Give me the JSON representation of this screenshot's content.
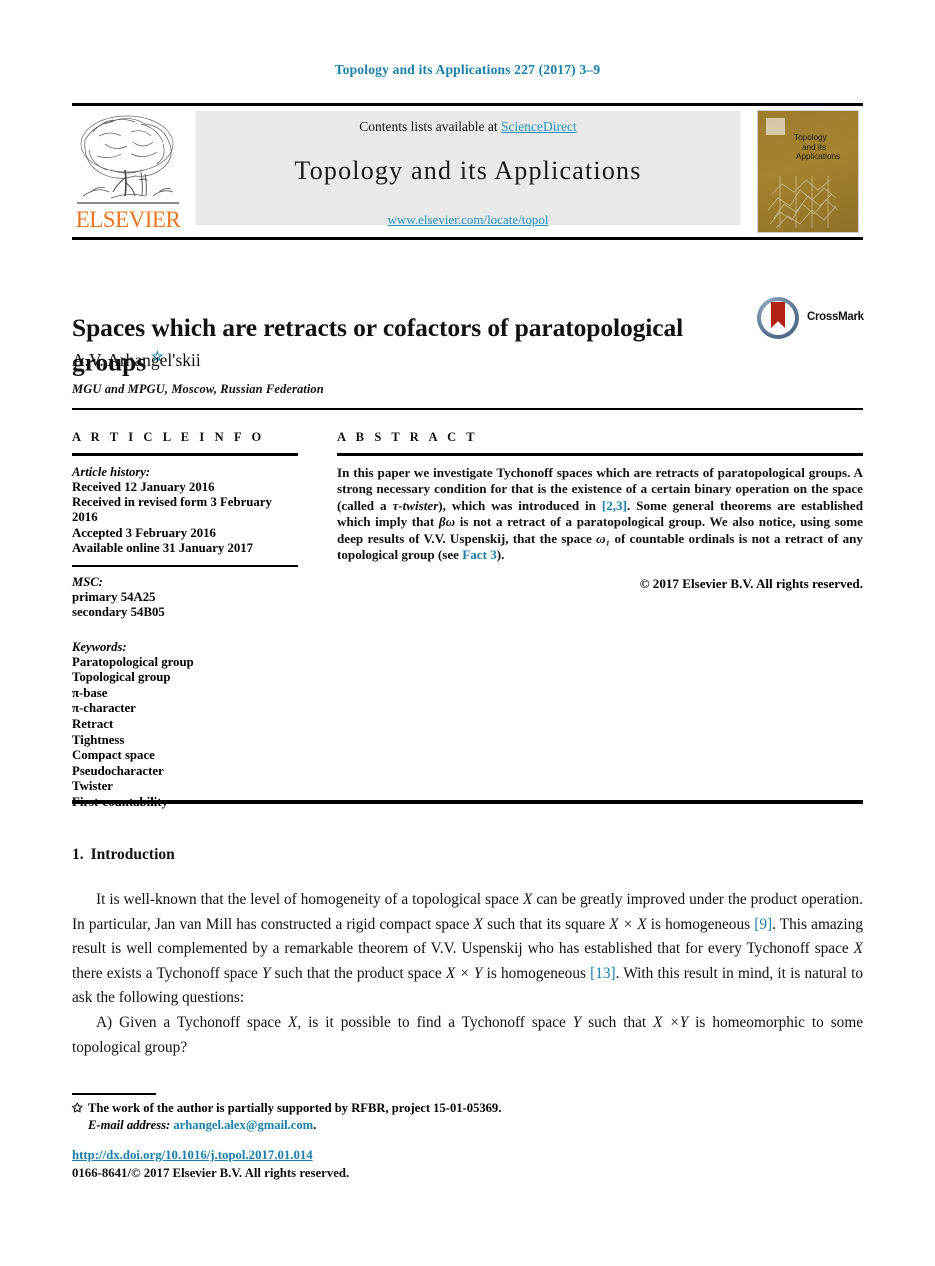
{
  "running_head": "Topology and its Applications 227 (2017) 3–9",
  "masthead": {
    "publisher_name": "ELSEVIER",
    "contents_prefix": "Contents lists available at ",
    "contents_link": "ScienceDirect",
    "journal_name": "Topology and its Applications",
    "journal_url": "www.elsevier.com/locate/topol",
    "cover": {
      "line1": "Topology",
      "line2": "and its",
      "line3": "Applications"
    }
  },
  "article": {
    "title": "Spaces which are retracts or cofactors of paratopological groups",
    "title_footnote_marker": "☆",
    "author": "A.V. Arhangel'skii",
    "affiliation": "MGU and MPGU, Moscow, Russian Federation"
  },
  "crossmark": {
    "label": "CrossMark"
  },
  "info": {
    "heading": "A R T I C L E   I N F O",
    "history_label": "Article history:",
    "history": [
      "Received 12 January 2016",
      "Received in revised form 3 February 2016",
      "Accepted 3 February 2016",
      "Available online 31 January 2017"
    ],
    "msc_label": "MSC:",
    "msc": [
      "primary 54A25",
      "secondary 54B05"
    ],
    "keywords_label": "Keywords:",
    "keywords": [
      "Paratopological group",
      "Topological group",
      "π-base",
      "π-character",
      "Retract",
      "Tightness",
      "Compact space",
      "Pseudocharacter",
      "Twister",
      "First-countability"
    ]
  },
  "abstract": {
    "heading": "A B S T R A C T",
    "part1": "In this paper we investigate Tychonoff spaces which are retracts of paratopological groups. A strong necessary condition for that is the existence of a certain binary operation on the space (called a ",
    "tau_twister": "τ-twister",
    "part2": "), which was introduced in ",
    "ref_23": "[2,3]",
    "part3": ". Some general theorems are established which imply that ",
    "beta_omega": "βω",
    "part4": " is not a retract of a paratopological group. We also notice, using some deep results of V.V. Uspenskij, that the space ",
    "omega_1": "ω₁",
    "part5": " of countable ordinals is not a retract of any topological group (see ",
    "ref_fact3": "Fact 3",
    "part6": ").",
    "copyright": "© 2017 Elsevier B.V. All rights reserved."
  },
  "body": {
    "section_number": "1.",
    "section_name": "Introduction",
    "p1_a": "It is well-known that the level of homogeneity of a topological space ",
    "p1_X1": "X",
    "p1_b": " can be greatly improved under the product operation. In particular, Jan van Mill has constructed a rigid compact space ",
    "p1_X2": "X",
    "p1_c": " such that its square ",
    "p1_XX": "X × X",
    "p1_d": " is homogeneous ",
    "p1_ref9": "[9]",
    "p1_e": ". This amazing result is well complemented by a remarkable theorem of V.V. Uspenskij who has established that for every Tychonoff space ",
    "p1_X3": "X",
    "p1_f": " there exists a Tychonoff space ",
    "p1_Y1": "Y",
    "p1_g": " such that the product space ",
    "p1_XY": "X × Y",
    "p1_h": " is homogeneous ",
    "p1_ref13": "[13]",
    "p1_i": ". With this result in mind, it is natural to ask the following questions:",
    "p2_a": "A) Given a Tychonoff space ",
    "p2_X1": "X",
    "p2_b": ", is it possible to find a Tychonoff space ",
    "p2_Y1": "Y",
    "p2_c": " such that ",
    "p2_XY": "X ×Y",
    "p2_d": " is homeomorphic to some topological group?"
  },
  "footnotes": {
    "star_marker": "✩",
    "support": "The work of the author is partially supported by RFBR, project 15-01-05369.",
    "email_label": "E-mail address:",
    "email": "arhangel.alex@gmail.com",
    "email_trail": ".",
    "doi": "http://dx.doi.org/10.1016/j.topol.2017.01.014",
    "issn": "0166-8641/© 2017 Elsevier B.V. All rights reserved."
  },
  "colors": {
    "link": "#1a7fa8",
    "elsevier_orange": "#e87722",
    "band_gray": "#e9e9e9",
    "cover_ochre": "#9d7d2d",
    "crossmark_red": "#b32014"
  }
}
